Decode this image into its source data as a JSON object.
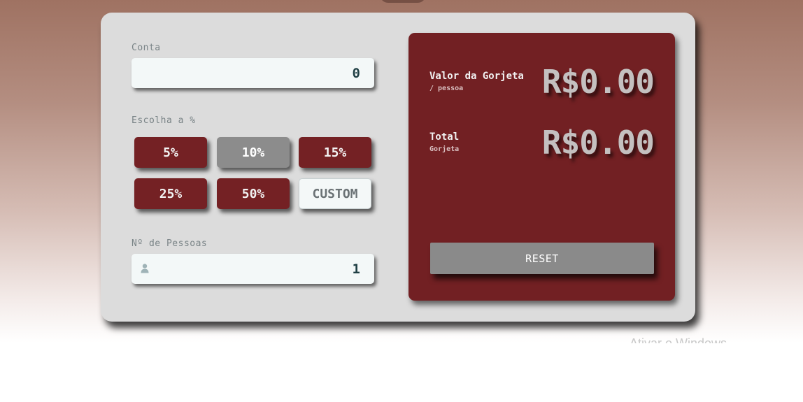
{
  "bill": {
    "label": "Conta",
    "value": "0"
  },
  "tip": {
    "label": "Escolha a %",
    "options": [
      {
        "label": "5%"
      },
      {
        "label": "10%",
        "selected": true
      },
      {
        "label": "15%"
      },
      {
        "label": "25%"
      },
      {
        "label": "50%"
      }
    ],
    "custom_label": "CUSTOM"
  },
  "people": {
    "label": "Nº de Pessoas",
    "value": "1",
    "icon": "person-icon"
  },
  "results": {
    "tip_amount": {
      "title": "Valor da Gorjeta",
      "sub": "/ pessoa",
      "value": "R$0.00"
    },
    "total": {
      "title": "Total",
      "sub": "Gorjeta",
      "value": "R$0.00"
    },
    "reset_label": "RESET"
  },
  "watermark": "Ativar o Windows",
  "colors": {
    "accent": "#722023",
    "selected": "#8c8c8c",
    "card": "#dcdcdc",
    "input": "#f3f8f8"
  }
}
